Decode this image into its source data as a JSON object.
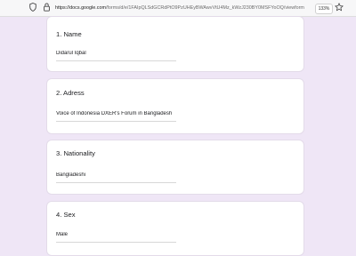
{
  "browser": {
    "url_domain": "https://docs.google.com",
    "url_path": "/forms/d/e/1FAIpQLSdGCRdPtO9PzUHEyBWAwvVtU4Mz_kWzJ230BY0MSFYoOQ/viewform",
    "zoom": "133%",
    "icons": [
      "shield-icon",
      "lock-icon",
      "star-icon"
    ]
  },
  "form": {
    "questions": [
      {
        "title": "1. Name",
        "answer": "Didarul Iqbal"
      },
      {
        "title": "2. Adress",
        "answer": "Voice of Indonesia DXER's Forum in Bangladesh"
      },
      {
        "title": "3. Nationality",
        "answer": "Bangladeshi"
      },
      {
        "title": "4. Sex",
        "answer": "Male"
      }
    ]
  }
}
